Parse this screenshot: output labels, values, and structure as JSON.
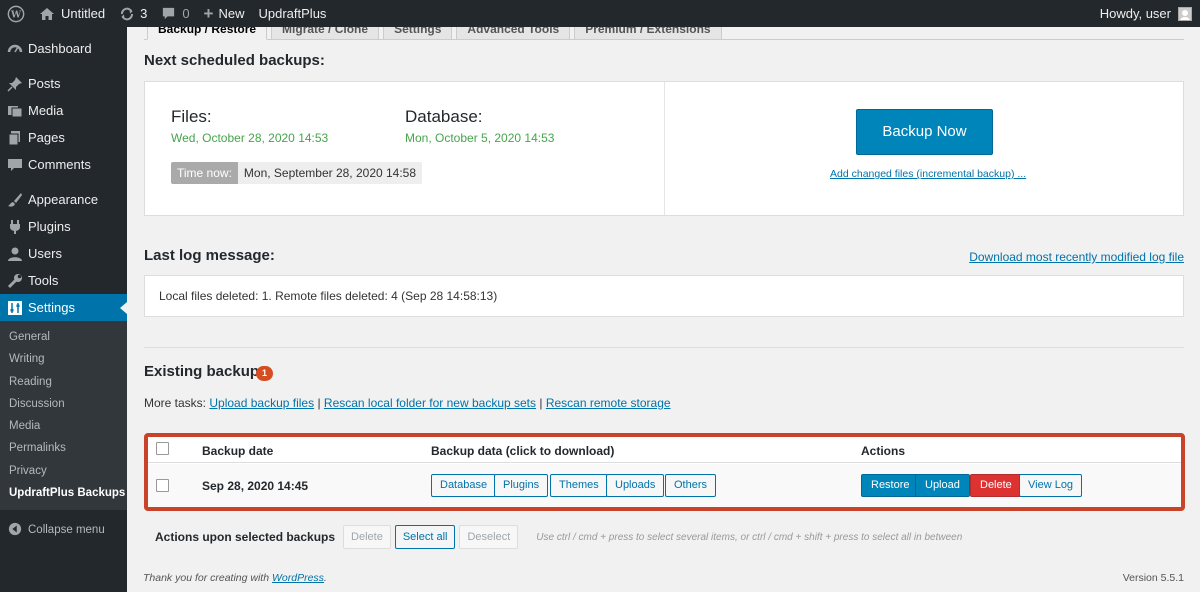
{
  "adminbar": {
    "site_name": "Untitled",
    "updates_count": "3",
    "comments_count": "0",
    "new_label": "New",
    "plugin_label": "UpdraftPlus",
    "howdy": "Howdy, user"
  },
  "sidebar": {
    "items": [
      {
        "label": "Dashboard",
        "icon": "dashboard-icon"
      },
      {
        "label": "Posts",
        "icon": "pin-icon"
      },
      {
        "label": "Media",
        "icon": "media-icon"
      },
      {
        "label": "Pages",
        "icon": "pages-icon"
      },
      {
        "label": "Comments",
        "icon": "comment-icon"
      },
      {
        "label": "Appearance",
        "icon": "brush-icon"
      },
      {
        "label": "Plugins",
        "icon": "plugin-icon"
      },
      {
        "label": "Users",
        "icon": "user-icon"
      },
      {
        "label": "Tools",
        "icon": "wrench-icon"
      },
      {
        "label": "Settings",
        "icon": "settings-icon"
      }
    ],
    "submenu": [
      "General",
      "Writing",
      "Reading",
      "Discussion",
      "Media",
      "Permalinks",
      "Privacy",
      "UpdraftPlus Backups"
    ],
    "collapse_label": "Collapse menu"
  },
  "tabs": [
    "Backup / Restore",
    "Migrate / Clone",
    "Settings",
    "Advanced Tools",
    "Premium / Extensions"
  ],
  "scheduled": {
    "heading": "Next scheduled backups:",
    "files_label": "Files:",
    "files_date": "Wed, October 28, 2020 14:53",
    "db_label": "Database:",
    "db_date": "Mon, October 5, 2020 14:53",
    "time_now_label": "Time now:",
    "time_now_value": "Mon, September 28, 2020 14:58",
    "backup_now_label": "Backup Now",
    "incremental_link": "Add changed files (incremental backup) ..."
  },
  "log": {
    "heading": "Last log message:",
    "download_link": "Download most recently modified log file",
    "message": "Local files deleted: 1. Remote files deleted: 4 (Sep 28 14:58:13)"
  },
  "existing": {
    "heading": "Existing backups",
    "count": "1",
    "more_tasks_label": "More tasks:",
    "link_upload": "Upload backup files",
    "link_rescan_local": "Rescan local folder for new backup sets",
    "link_rescan_remote": "Rescan remote storage",
    "sep": "|",
    "columns": {
      "date": "Backup date",
      "data": "Backup data (click to download)",
      "actions": "Actions"
    },
    "row": {
      "date": "Sep 28, 2020 14:45",
      "data_buttons": [
        "Database",
        "Plugins",
        "Themes",
        "Uploads",
        "Others"
      ],
      "restore": "Restore",
      "upload": "Upload",
      "delete": "Delete",
      "view_log": "View Log"
    }
  },
  "bulk": {
    "label": "Actions upon selected backups",
    "delete": "Delete",
    "select_all": "Select all",
    "deselect": "Deselect",
    "hint": "Use ctrl / cmd + press to select several items, or ctrl / cmd + shift + press to select all in between"
  },
  "footer": {
    "thanks_prefix": "Thank you for creating with",
    "wordpress_link": "WordPress",
    "thanks_suffix": ".",
    "version": "Version 5.5.1"
  }
}
